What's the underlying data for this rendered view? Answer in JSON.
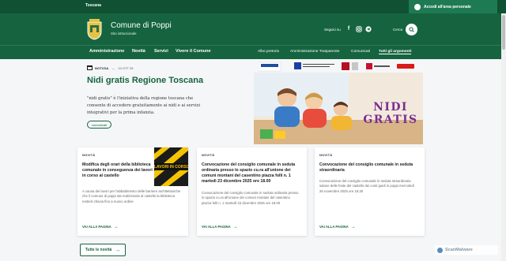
{
  "slim_header": {
    "region": "Toscana",
    "login_label": "Accedi all'area personale"
  },
  "header": {
    "title": "Comune di Poppi",
    "subtitle": "Sito istituzionale",
    "follow_label": "Seguici su",
    "search_label": "Cerca"
  },
  "nav": {
    "main": [
      "Amministrazione",
      "Novità",
      "Servizi",
      "Vivere il Comune"
    ],
    "secondary": [
      "Albo pretorio",
      "Amministrazione Trasparente",
      "Comunicati",
      "Tutti gli argomenti"
    ]
  },
  "hero": {
    "tag": "NOTIZIA",
    "date": "24 OTT 25",
    "title": "Nidi gratis Regione Toscana",
    "text": "\"nidi gratis\" è l'iniziativa della regione toscana che consente di accedere gratuitamente ai nidi e ai servizi integrativi per la prima infanzia.",
    "chip": "comunicati",
    "image_caption": "NIDI GRATIS"
  },
  "cards": [
    {
      "type": "NOVITÀ",
      "title": "Modifica degli orari della biblioteca comunale in conseguenza dei lavori in corso al castello",
      "desc": "A causa dei lavori per l'abbattimento delle barriere architettoniche che il comune di poppi sta realizzando al castello la biblioteca resterà chiusa fino a nuovo ordine",
      "link": "VAI ALLA PAGINA",
      "thumb_text": "LAVORI IN CORSO"
    },
    {
      "type": "NOVITÀ",
      "title": "Convocazione del consiglio comunale in seduta ordinaria presso lo spazio cu.ra all'unione dei comuni montani del casentino piazza folli n. 1 martedì 23 dicembre 2025 ore 18.00",
      "desc": "Convocazione del consiglio comunale in seduta ordinaria presso lo spazio cu.ra all'unione dei comuni montani del casentino piazza folli n. 1 martedì 23 dicembre 2025 ore 18.00",
      "link": "VAI ALLA PAGINA"
    },
    {
      "type": "NOVITÀ",
      "title": "Convocazione del consiglio comunale in seduta straordinaria",
      "desc": "Convocazione del consiglio comunale in seduta straordinaria salone delle feste del castello dei conti guidi in poppi mercoledì 26 novembre 2025 ore 18.30",
      "link": "VAI ALLA PAGINA"
    }
  ],
  "all_news_label": "Tutte le novità",
  "watermark": "ScanMalware",
  "colors": {
    "primary": "#15643f",
    "slim": "#0f5132",
    "login_bg": "#1e7a52"
  }
}
